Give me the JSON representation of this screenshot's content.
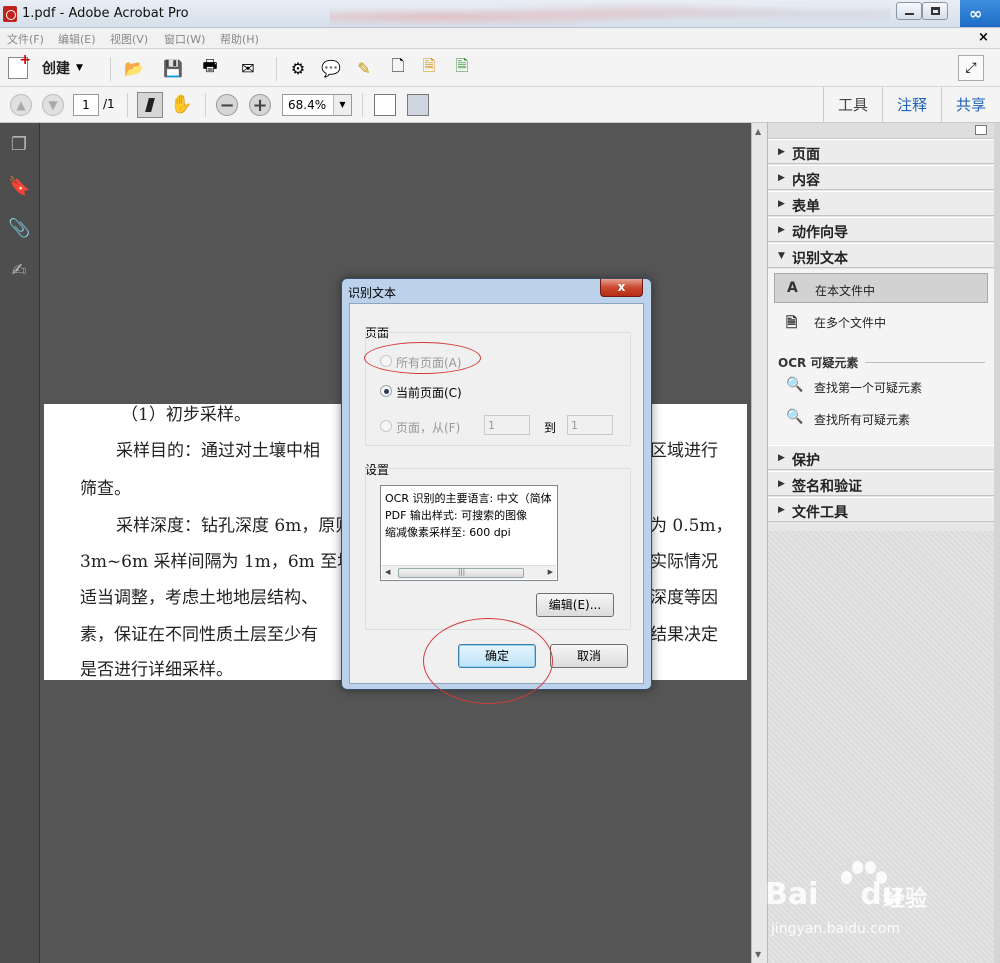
{
  "window": {
    "title": "1.pdf - Adobe Acrobat Pro"
  },
  "menu": [
    "文件(F)",
    "编辑(E)",
    "视图(V)",
    "窗口(W)",
    "帮助(H)"
  ],
  "toolbar": {
    "create_label": "创建"
  },
  "nav": {
    "page_current": "1",
    "page_total": "/1",
    "zoom": "68.4%"
  },
  "right_tabs": [
    "工具",
    "注释",
    "共享"
  ],
  "document": {
    "lines": [
      "（1）初步采样。",
      "采样目的：通过对土壤中相",
      "区域进行",
      "筛查。",
      "采样深度：钻孔深度 6m，原则",
      "为 0.5m，",
      "3m~6m 采样间隔为 1m，6m 至地",
      "实际情况",
      "适当调整，考虑土地地层结构、",
      "深度等因",
      "素，保证在不同性质土层至少有",
      "结果决定",
      "是否进行详细采样。"
    ]
  },
  "panel": {
    "sections_top": [
      "页面",
      "内容",
      "表单",
      "动作向导",
      "识别文本"
    ],
    "ocr_items": [
      "在本文件中",
      "在多个文件中"
    ],
    "ocr_suspects_heading": "OCR 可疑元素",
    "suspect_items": [
      "查找第一个可疑元素",
      "查找所有可疑元素"
    ],
    "sections_bottom": [
      "保护",
      "签名和验证",
      "文件工具"
    ]
  },
  "dialog": {
    "title": "识别文本",
    "close_label": "x",
    "pages_group": "页面",
    "option_all": "所有页面(A)",
    "option_current": "当前页面(C)",
    "option_range": "页面，从(F)",
    "range_from": "1",
    "range_to_label": "到",
    "range_to": "1",
    "settings_group": "设置",
    "settings_lines": [
      "OCR 识别的主要语言: 中文（简体",
      "PDF 输出样式: 可搜索的图像",
      "缩减像素采样至: 600 dpi"
    ],
    "edit_button": "编辑(E)...",
    "ok_button": "确定",
    "cancel_button": "取消"
  },
  "watermark": {
    "brand": "Bai",
    "brand2": "du",
    "cn": "经验",
    "url": "jingyan.baidu.com"
  },
  "colors": {
    "accent_blue": "#1d62b7",
    "annotation_red": "#d23a3a",
    "dialog_frame": "#bcd1ea",
    "doc_bg": "#555555"
  }
}
